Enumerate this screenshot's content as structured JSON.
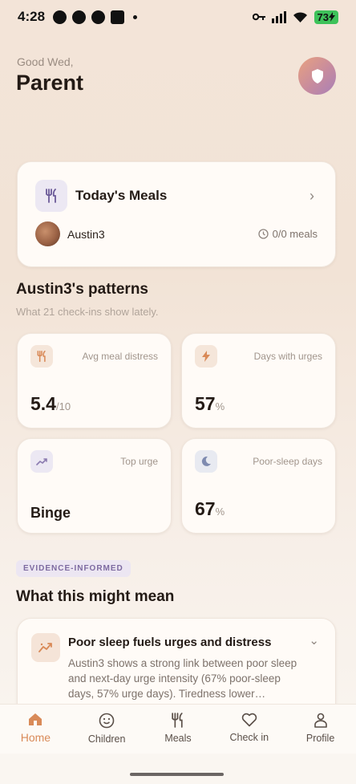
{
  "status_bar": {
    "time": "4:28",
    "battery": "73"
  },
  "header": {
    "greeting": "Good Wed,",
    "title": "Parent"
  },
  "meals_card": {
    "title": "Today's Meals",
    "child_name": "Austin3",
    "meal_count": "0/0 meals"
  },
  "patterns": {
    "title": "Austin3's patterns",
    "subtitle": "What 21 check-ins show lately.",
    "stats": [
      {
        "label": "Avg meal distress",
        "value": "5.4",
        "unit": "/10",
        "icon": "utensils-icon",
        "icon_bg": "#f5e6da",
        "icon_color": "#d98a58"
      },
      {
        "label": "Days with urges",
        "value": "57",
        "unit": "%",
        "icon": "bolt-icon",
        "icon_bg": "#f5e6da",
        "icon_color": "#d98a58"
      },
      {
        "label": "Top urge",
        "value": "Binge",
        "unit": "",
        "icon": "trend-icon",
        "icon_bg": "#ece8f3",
        "icon_color": "#8b7bb0"
      },
      {
        "label": "Poor-sleep days",
        "value": "67",
        "unit": "%",
        "icon": "moon-icon",
        "icon_bg": "#e8eaf1",
        "icon_color": "#7f8bb0"
      }
    ]
  },
  "evidence": {
    "badge": "EVIDENCE-INFORMED",
    "title": "What this might mean",
    "insight_title": "Poor sleep fuels urges and distress",
    "insight_body": "Austin3 shows a strong link between poor sleep and next-day urge intensity (67% poor-sleep days, 57% urge days). Tiredness lower…"
  },
  "nav": [
    {
      "label": "Home",
      "icon": "home-icon",
      "active": true
    },
    {
      "label": "Children",
      "icon": "smiley-icon",
      "active": false
    },
    {
      "label": "Meals",
      "icon": "utensils-icon",
      "active": false
    },
    {
      "label": "Check in",
      "icon": "heart-icon",
      "active": false
    },
    {
      "label": "Profile",
      "icon": "person-icon",
      "active": false
    }
  ],
  "colors": {
    "accent": "#d98a58",
    "text": "#231a15",
    "muted": "#a1958c"
  }
}
